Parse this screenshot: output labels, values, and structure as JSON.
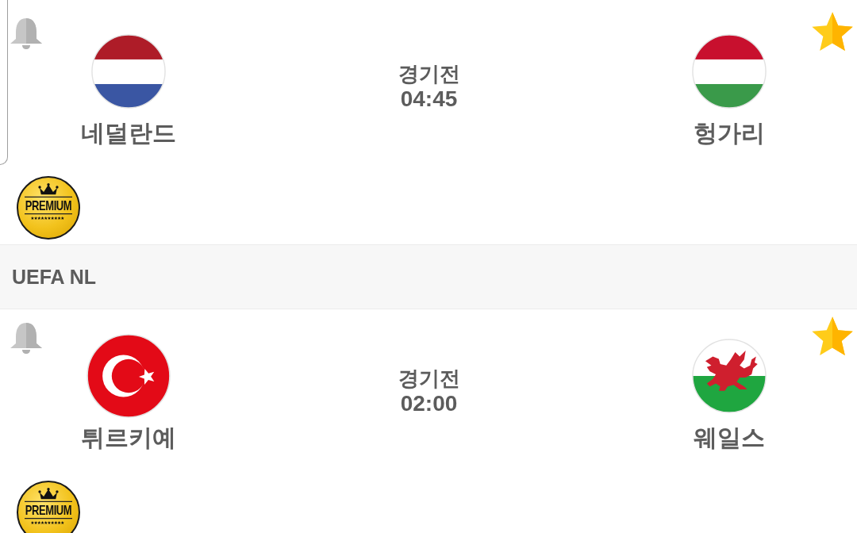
{
  "sections": [
    {
      "matches": [
        {
          "notify": false,
          "favorite": true,
          "home": {
            "name": "네덜란드",
            "kind": "netherlands"
          },
          "status": "경기전",
          "time": "04:45",
          "away": {
            "name": "헝가리",
            "kind": "hungary"
          },
          "badge": "PREMIUM"
        }
      ]
    },
    {
      "league": "UEFA NL",
      "matches": [
        {
          "notify": false,
          "favorite": true,
          "home": {
            "name": "튀르키예",
            "kind": "turkey"
          },
          "status": "경기전",
          "time": "02:00",
          "away": {
            "name": "웨일스",
            "kind": "wales"
          },
          "badge": "PREMIUM"
        }
      ]
    }
  ]
}
